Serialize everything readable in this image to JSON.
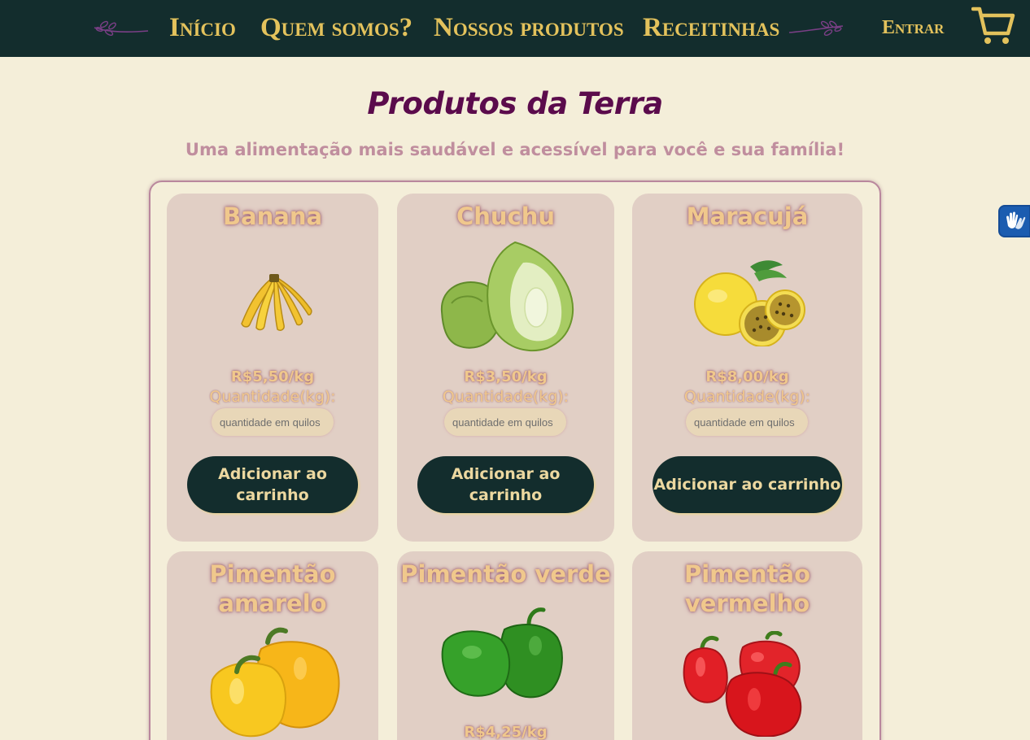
{
  "nav": {
    "links": [
      "Início",
      "Quem somos?",
      "Nossos produtos",
      "Receitinhas"
    ],
    "login": "Entrar"
  },
  "heading": {
    "title": "Produtos da Terra",
    "subtitle": "Uma alimentação mais saudável e acessível para você e sua família!"
  },
  "products": [
    {
      "name": "Banana",
      "price": "R$5,50/kg",
      "qty_label": "Quantidade(kg):",
      "qty_placeholder": "quantidade em quilos",
      "button": "Adicionar ao carrinho"
    },
    {
      "name": "Chuchu",
      "price": "R$3,50/kg",
      "qty_label": "Quantidade(kg):",
      "qty_placeholder": "quantidade em quilos",
      "button": "Adicionar ao carrinho"
    },
    {
      "name": "Maracujá",
      "price": "R$8,00/kg",
      "qty_label": "Quantidade(kg):",
      "qty_placeholder": "quantidade em quilos",
      "button": "Adicionar ao carrinho"
    },
    {
      "name": "Pimentão amarelo"
    },
    {
      "name": "Pimentão verde",
      "price": "R$4,25/kg"
    },
    {
      "name": "Pimentão vermelho"
    }
  ],
  "colors": {
    "header": "#132d2d",
    "nav_text": "#e3c25c",
    "background": "#f4eed9",
    "card": "#e1cfc5",
    "title": "#5b0b4c",
    "subtitle": "#c08e9e",
    "button": "#132d2d"
  },
  "icons": [
    "sprig-left-icon",
    "sprig-right-icon",
    "cart-icon",
    "sign-language-icon"
  ]
}
